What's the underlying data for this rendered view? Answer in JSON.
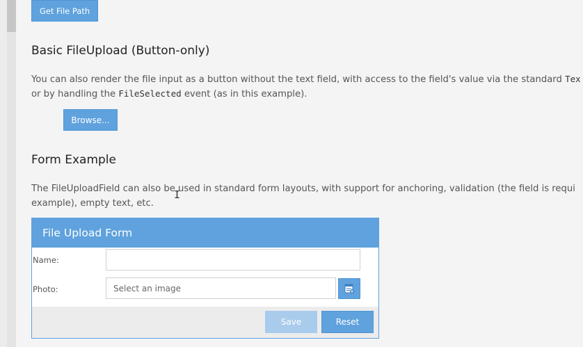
{
  "top_button": {
    "label": "Get File Path"
  },
  "section_button_only": {
    "title": "Basic FileUpload (Button-only)",
    "desc_line1_pre": "You can also render the file input as a button without the text field, with access to the field's value via the standard ",
    "desc_line1_code": "Tex",
    "desc_line2_pre": "or by handling the ",
    "desc_line2_code": "FileSelected",
    "desc_line2_post": " event (as in this example).",
    "browse_label": "Browse..."
  },
  "section_form": {
    "title": "Form Example",
    "desc_line1": "The FileUploadField can also be used in standard form layouts, with support for anchoring, validation (the field is requi",
    "desc_line2": "example), empty text, etc."
  },
  "form_panel": {
    "title": "File Upload Form",
    "name_label": "Name:",
    "name_value": "",
    "photo_label": "Photo:",
    "photo_placeholder": "Select an image",
    "photo_icon": "file-upload-icon",
    "save_label": "Save",
    "reset_label": "Reset"
  },
  "colors": {
    "accent": "#5fa2dd",
    "disabled_button": "#a9cbec",
    "page_background": "#f4f4f4"
  }
}
